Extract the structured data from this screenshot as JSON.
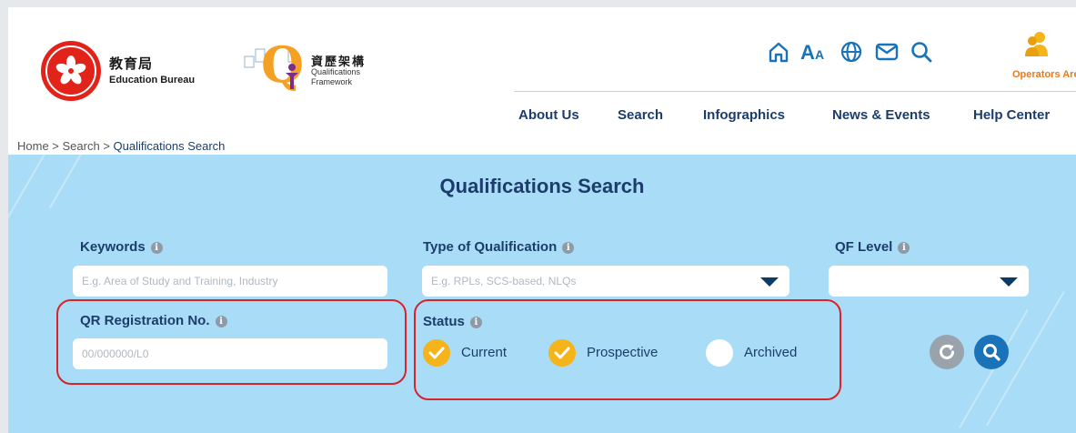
{
  "header": {
    "edb_name_zh": "教育局",
    "edb_name_en": "Education Bureau",
    "qf_name_zh": "資歷架構",
    "qf_name_en_line1": "Qualifications",
    "qf_name_en_line2": "Framework",
    "tools": [
      "home-icon",
      "font-size-icon",
      "language-icon",
      "mail-icon",
      "search-icon"
    ],
    "operators_label": "Operators Area"
  },
  "nav": {
    "items": [
      "About Us",
      "Search",
      "Infographics",
      "News & Events",
      "Help Center"
    ]
  },
  "breadcrumb": {
    "home": "Home",
    "search": "Search",
    "current": "Qualifications Search",
    "separator": " > "
  },
  "search_panel": {
    "title": "Qualifications Search",
    "keywords": {
      "label": "Keywords",
      "placeholder": "E.g. Area of Study and Training, Industry"
    },
    "type": {
      "label": "Type of Qualification",
      "placeholder": "E.g. RPLs, SCS-based, NLQs"
    },
    "qf_level": {
      "label": "QF Level",
      "value": ""
    },
    "qr_no": {
      "label": "QR Registration No.",
      "placeholder": "00/000000/L0"
    },
    "status": {
      "label": "Status",
      "options": [
        {
          "label": "Current",
          "checked": true
        },
        {
          "label": "Prospective",
          "checked": true
        },
        {
          "label": "Archived",
          "checked": false
        }
      ]
    },
    "info_glyph": "i"
  },
  "colors": {
    "panel_bg": "#a9dcf6",
    "navy": "#1c3d6b",
    "check_on": "#f4b41a",
    "search_btn": "#1a73b8",
    "reset_btn": "#9aa3ab",
    "highlight": "#d9222a",
    "operators": "#e87a1e"
  }
}
